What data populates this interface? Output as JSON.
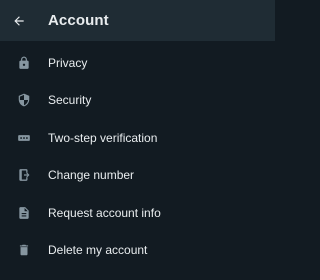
{
  "header": {
    "title": "Account",
    "back_icon": "arrow-left-icon"
  },
  "colors": {
    "background": "#121b22",
    "header_background": "#1f2c34",
    "text": "#e9edef",
    "icon": "#8696a0"
  },
  "items": [
    {
      "label": "Privacy",
      "icon": "lock-icon"
    },
    {
      "label": "Security",
      "icon": "shield-icon"
    },
    {
      "label": "Two-step verification",
      "icon": "password-dots-icon"
    },
    {
      "label": "Change number",
      "icon": "phone-change-icon"
    },
    {
      "label": "Request account info",
      "icon": "document-icon"
    },
    {
      "label": "Delete my account",
      "icon": "trash-icon"
    }
  ]
}
